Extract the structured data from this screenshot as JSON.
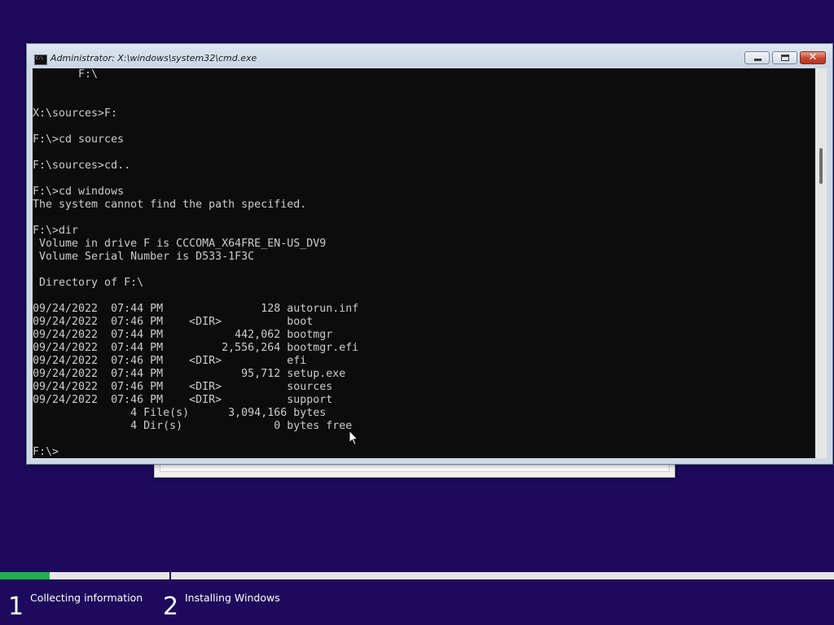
{
  "window": {
    "title": "Administrator: X:\\windows\\system32\\cmd.exe",
    "icon": "cmd-icon",
    "buttons": {
      "minimize": "minimize-icon",
      "maximize": "maximize-icon",
      "close": "✕"
    }
  },
  "console": {
    "lines": [
      "       F:\\",
      "",
      "",
      "X:\\sources>F:",
      "",
      "F:\\>cd sources",
      "",
      "F:\\sources>cd..",
      "",
      "F:\\>cd windows",
      "The system cannot find the path specified.",
      "",
      "F:\\>dir",
      " Volume in drive F is CCCOMA_X64FRE_EN-US_DV9",
      " Volume Serial Number is D533-1F3C",
      "",
      " Directory of F:\\",
      "",
      "09/24/2022  07:44 PM               128 autorun.inf",
      "09/24/2022  07:46 PM    <DIR>          boot",
      "09/24/2022  07:44 PM           442,062 bootmgr",
      "09/24/2022  07:44 PM         2,556,264 bootmgr.efi",
      "09/24/2022  07:46 PM    <DIR>          efi",
      "09/24/2022  07:44 PM            95,712 setup.exe",
      "09/24/2022  07:46 PM    <DIR>          sources",
      "09/24/2022  07:46 PM    <DIR>          support",
      "               4 File(s)      3,094,166 bytes",
      "               4 Dir(s)              0 bytes free",
      "",
      "F:\\>"
    ]
  },
  "setup_steps": [
    {
      "number": "1",
      "label": "Collecting information"
    },
    {
      "number": "2",
      "label": "Installing Windows"
    }
  ],
  "progress": {
    "value": 0.06
  },
  "colors": {
    "background": "#1d0a5c",
    "progress_fill": "#20b04b",
    "console_bg": "#0c0c0c",
    "console_fg": "#cccccc"
  }
}
